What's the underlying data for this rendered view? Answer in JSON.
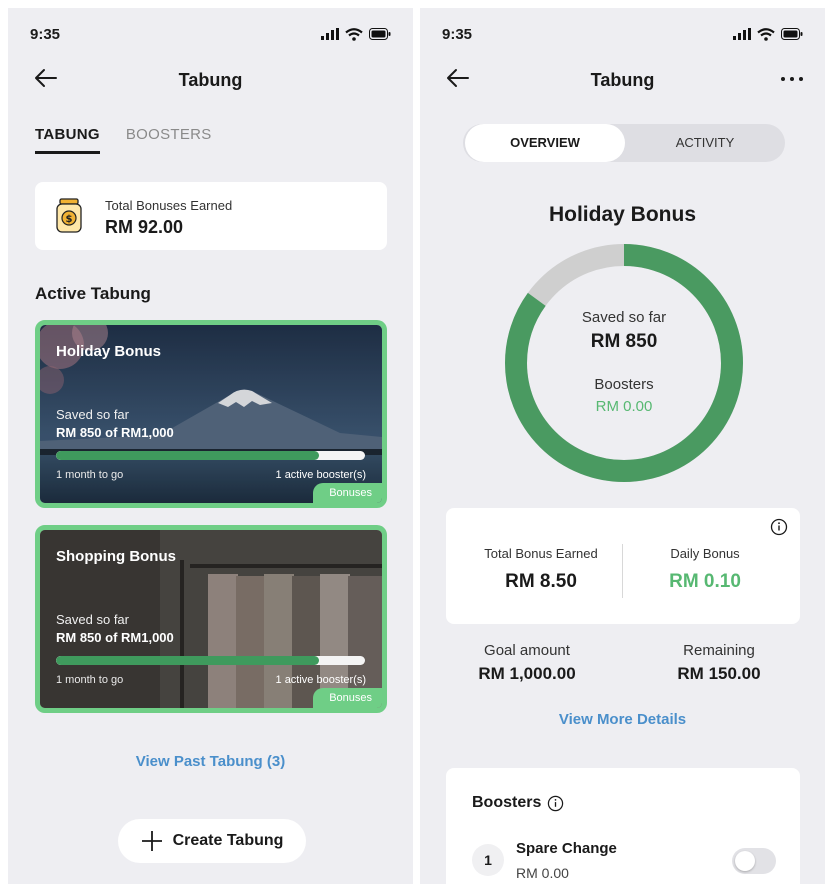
{
  "status": {
    "time": "9:35"
  },
  "left": {
    "title": "Tabung",
    "tabs": [
      {
        "label": "TABUNG"
      },
      {
        "label": "BOOSTERS"
      }
    ],
    "total": {
      "label": "Total Bonuses Earned",
      "value": "RM 92.00"
    },
    "section_title": "Active Tabung",
    "cards": [
      {
        "name": "Holiday Bonus",
        "saved_label": "Saved so far",
        "saved_value": "RM 850 of RM1,000",
        "progress": 0.85,
        "time_left": "1 month to go",
        "boosters": "1 active booster(s)",
        "badge": "Bonuses"
      },
      {
        "name": "Shopping Bonus",
        "saved_label": "Saved so far",
        "saved_value": "RM 850 of RM1,000",
        "progress": 0.85,
        "time_left": "1 month to go",
        "boosters": "1 active booster(s)",
        "badge": "Bonuses"
      }
    ],
    "view_past": "View Past Tabung (3)",
    "create_label": "Create Tabung"
  },
  "right": {
    "title": "Tabung",
    "segments": [
      {
        "label": "OVERVIEW"
      },
      {
        "label": "ACTIVITY"
      }
    ],
    "goal_name": "Holiday Bonus",
    "donut": {
      "progress": 0.85,
      "saved_label": "Saved so far",
      "saved_value": "RM 850",
      "boosters_label": "Boosters",
      "boosters_value": "RM 0.00"
    },
    "bonus": {
      "total_label": "Total Bonus Earned",
      "total_value": "RM 8.50",
      "daily_label": "Daily Bonus",
      "daily_value": "RM 0.10"
    },
    "goal": {
      "label": "Goal amount",
      "value": "RM 1,000.00"
    },
    "remaining": {
      "label": "Remaining",
      "value": "RM 150.00"
    },
    "view_more": "View More Details",
    "boosters": {
      "title": "Boosters",
      "items": [
        {
          "index": "1",
          "name": "Spare Change",
          "value": "RM 0.00",
          "enabled": false
        }
      ]
    }
  },
  "colors": {
    "accent_green": "#3f9a5d",
    "card_border_green": "#6fce86",
    "link_blue": "#4a8fcb",
    "donut_track": "#cfcfcf"
  }
}
